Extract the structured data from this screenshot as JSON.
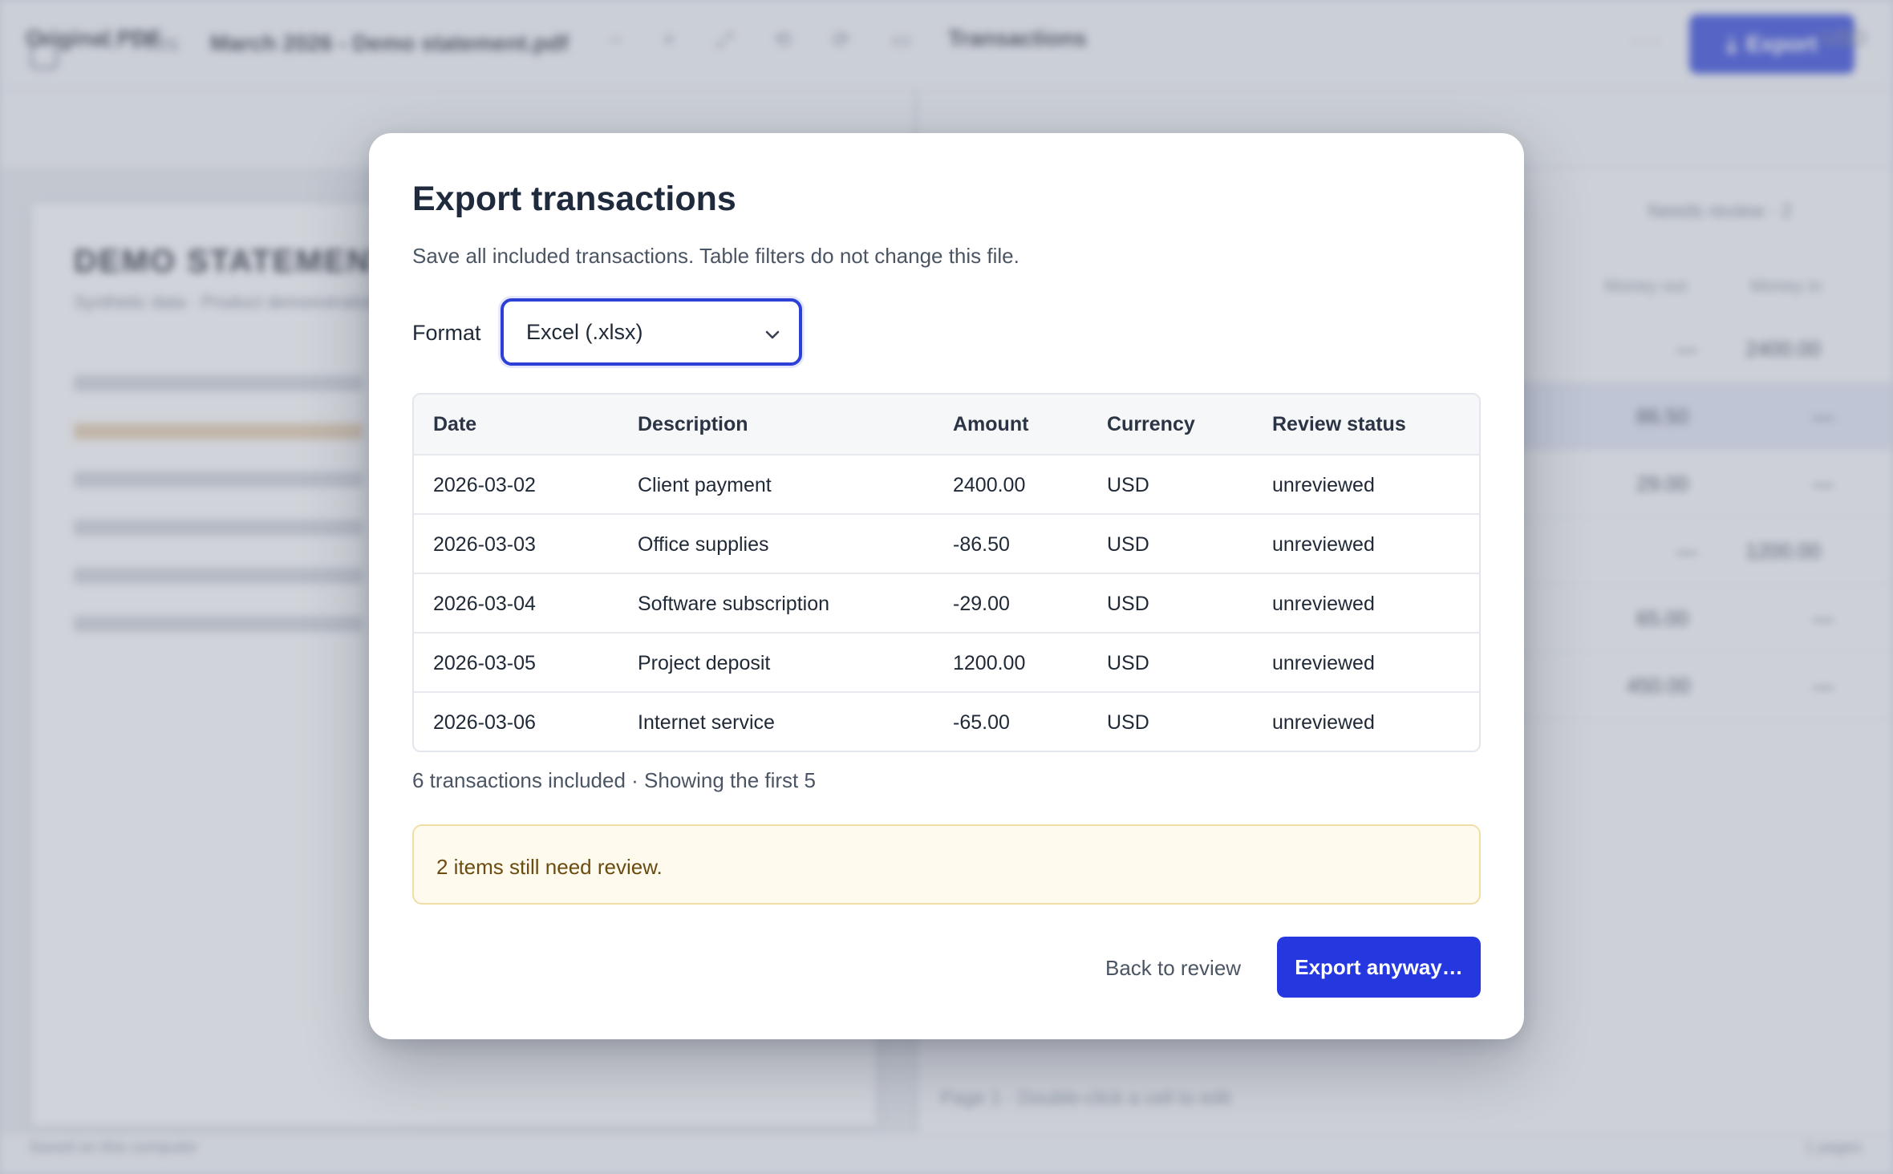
{
  "background": {
    "back_label": "Files",
    "document_title": "March 2026 - Demo statement.pdf",
    "export_label": "Export",
    "left_panel_title": "Original PDF",
    "right_panel_title": "Transactions",
    "currency": "USD",
    "needs_review": "Needs review · 2",
    "paper_title": "DEMO STATEMENT",
    "paper_subtitle": "Synthetic data · Product demonstration",
    "column_money_out": "Money out",
    "column_money_in": "Money in",
    "rows": [
      {
        "out": "—",
        "in": "2400.00"
      },
      {
        "out": "86.50",
        "in": "—"
      },
      {
        "out": "29.00",
        "in": "—"
      },
      {
        "out": "—",
        "in": "1200.00"
      },
      {
        "out": "65.00",
        "in": "—"
      },
      {
        "out": "450.00",
        "in": "—"
      }
    ],
    "page_note": "Page 1 · Double-click a cell to edit",
    "footer_left": "Saved on this computer",
    "footer_right": "1 pages"
  },
  "modal": {
    "title": "Export transactions",
    "subtitle": "Save all included transactions. Table filters do not change this file.",
    "format_label": "Format",
    "format_value": "Excel (.xlsx)",
    "table": {
      "headers": [
        "Date",
        "Description",
        "Amount",
        "Currency",
        "Review status"
      ],
      "rows": [
        [
          "2026-03-02",
          "Client payment",
          "2400.00",
          "USD",
          "unreviewed"
        ],
        [
          "2026-03-03",
          "Office supplies",
          "-86.50",
          "USD",
          "unreviewed"
        ],
        [
          "2026-03-04",
          "Software subscription",
          "-29.00",
          "USD",
          "unreviewed"
        ],
        [
          "2026-03-05",
          "Project deposit",
          "1200.00",
          "USD",
          "unreviewed"
        ],
        [
          "2026-03-06",
          "Internet service",
          "-65.00",
          "USD",
          "unreviewed"
        ]
      ]
    },
    "count_note": "6 transactions included · Showing the first 5",
    "warning": "2 items still need review.",
    "back_label": "Back to review",
    "export_label": "Export anyway…"
  },
  "colors": {
    "accent": "#2538e0",
    "warning_bg": "#fefaee",
    "warning_border": "#f0dea6"
  },
  "icons": [
    "sidebar-toggle-icon",
    "back-arrow-icon",
    "download-icon",
    "chevron-down-icon",
    "more-icon"
  ]
}
